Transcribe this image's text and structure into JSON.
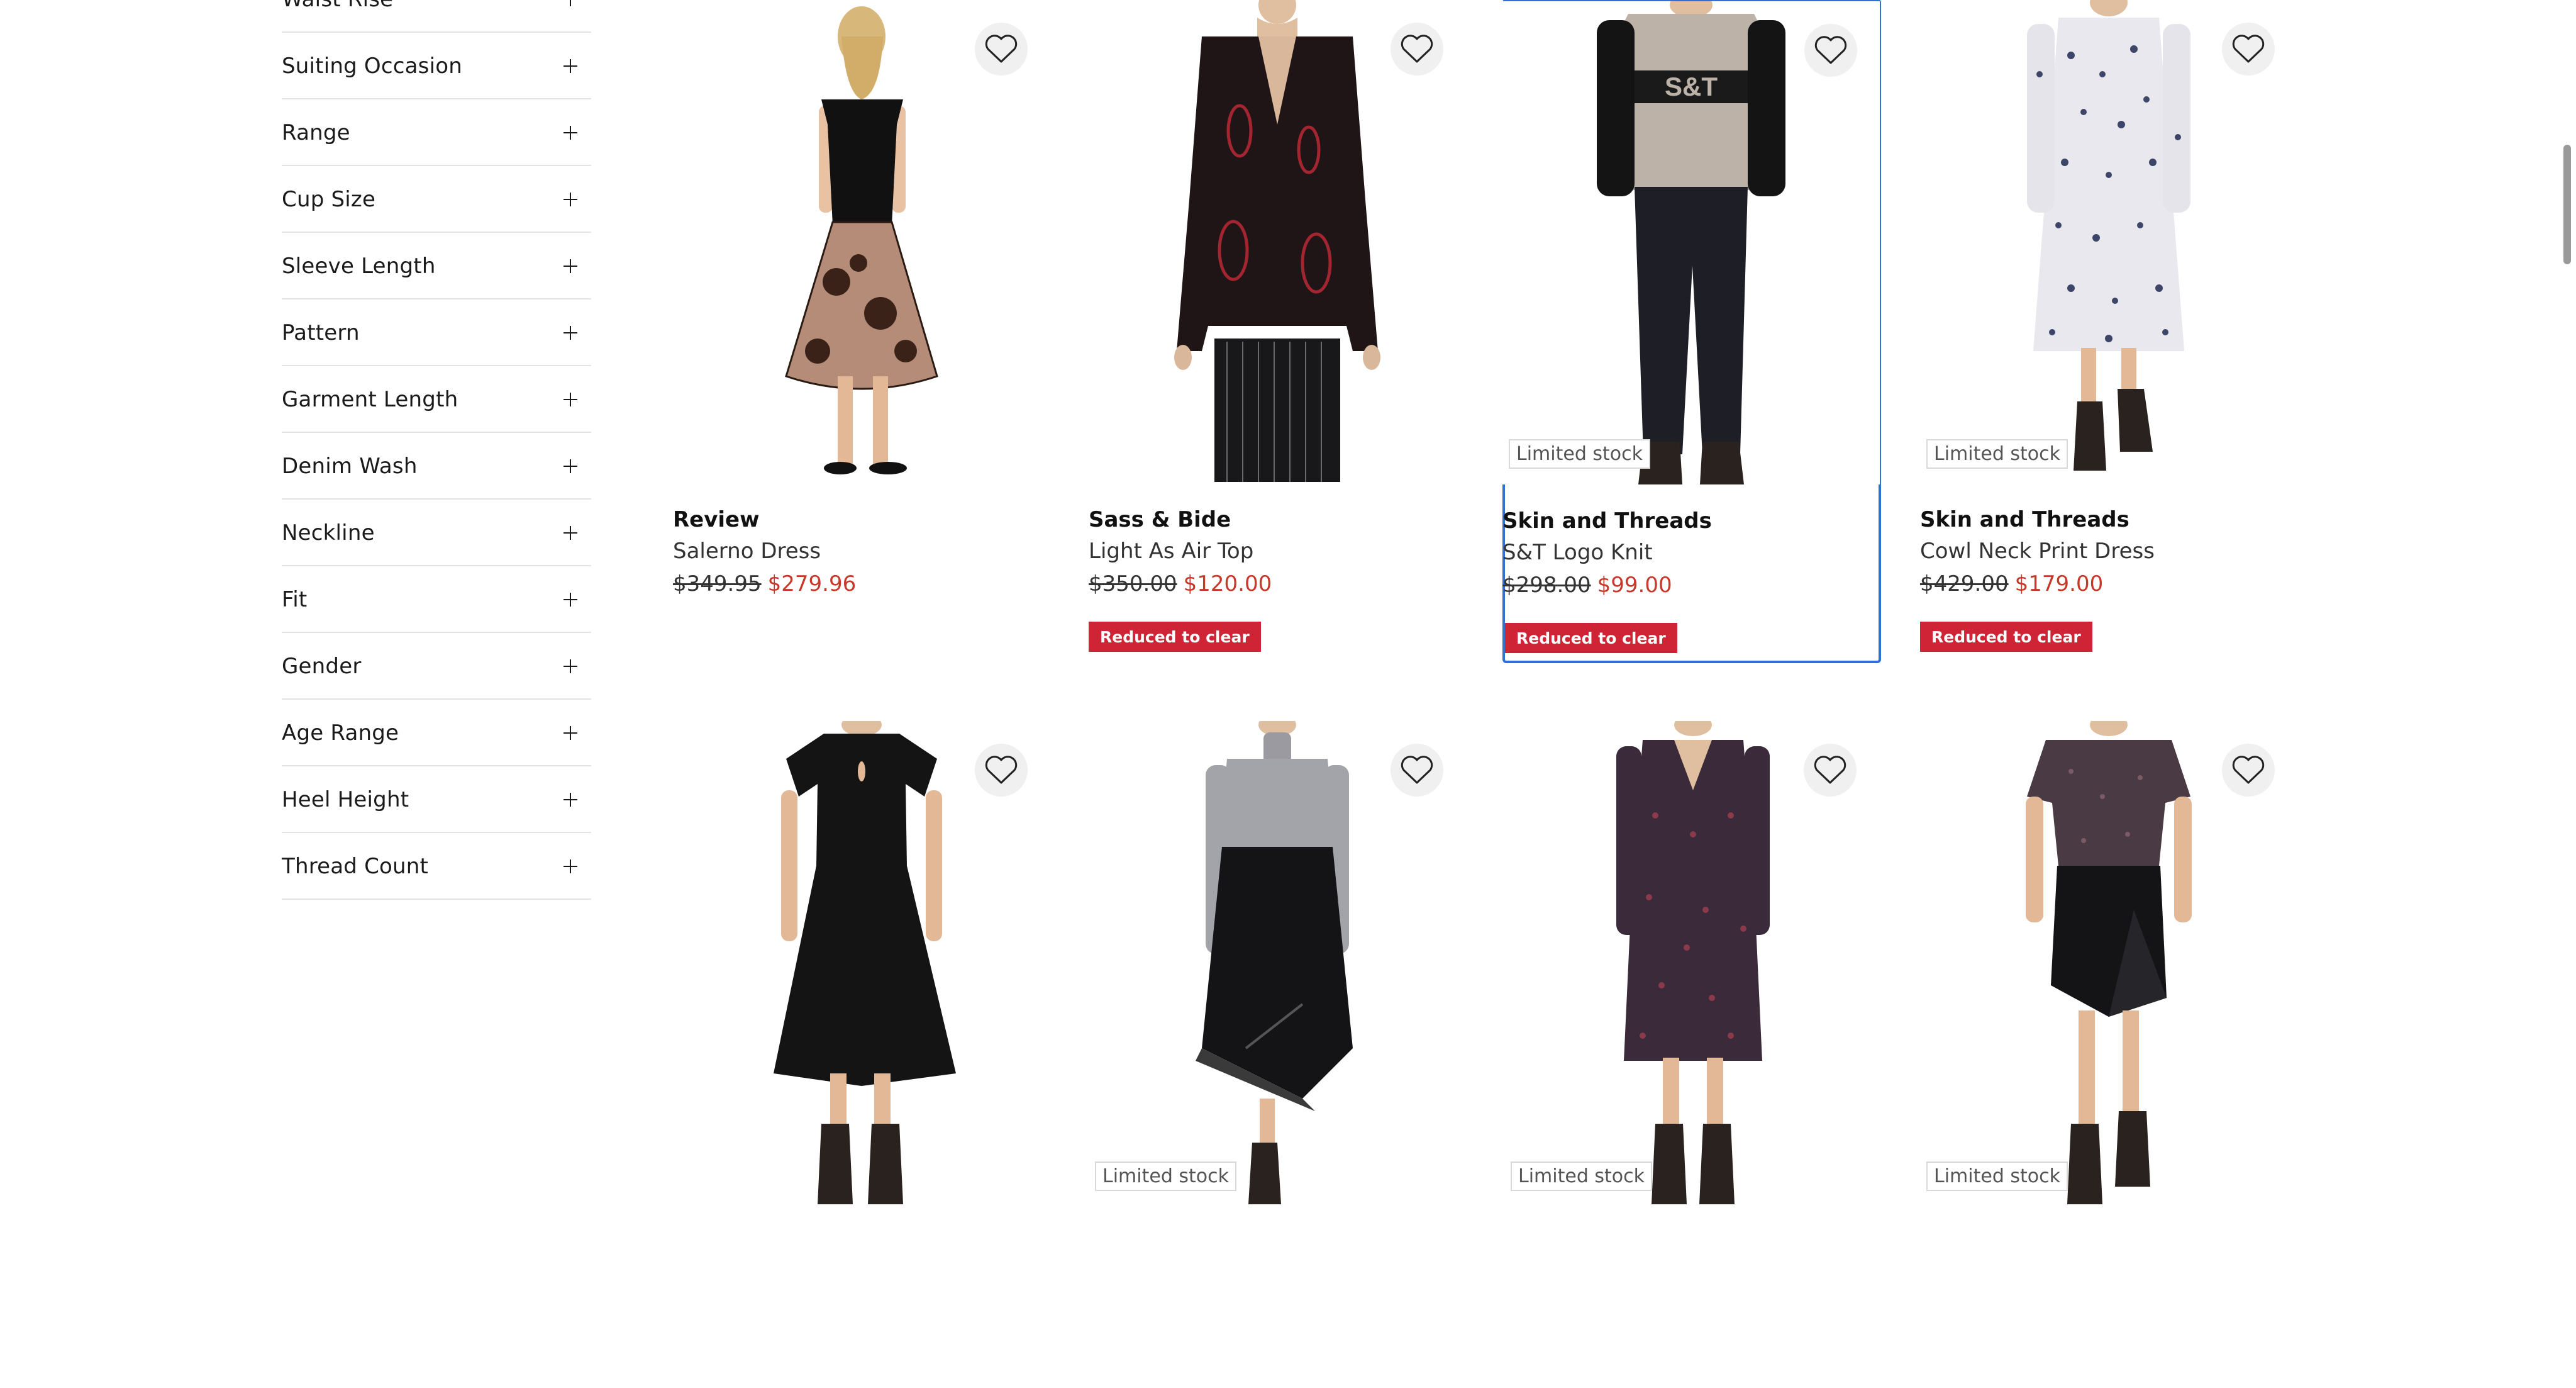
{
  "filters": [
    {
      "label": "Waist Rise"
    },
    {
      "label": "Suiting Occasion"
    },
    {
      "label": "Range"
    },
    {
      "label": "Cup Size"
    },
    {
      "label": "Sleeve Length"
    },
    {
      "label": "Pattern"
    },
    {
      "label": "Garment Length"
    },
    {
      "label": "Denim Wash"
    },
    {
      "label": "Neckline"
    },
    {
      "label": "Fit"
    },
    {
      "label": "Gender"
    },
    {
      "label": "Age Range"
    },
    {
      "label": "Heel Height"
    },
    {
      "label": "Thread Count"
    }
  ],
  "products": [
    {
      "brand": "Review",
      "name": "Salerno Dress",
      "old_price": "$349.95",
      "new_price": "$279.96",
      "badge": "",
      "tag": ""
    },
    {
      "brand": "Sass & Bide",
      "name": "Light As Air Top",
      "old_price": "$350.00",
      "new_price": "$120.00",
      "badge": "",
      "tag": "Reduced to clear"
    },
    {
      "brand": "Skin and Threads",
      "name": "S&T Logo Knit",
      "old_price": "$298.00",
      "new_price": "$99.00",
      "badge": "Limited stock",
      "tag": "Reduced to clear",
      "logo_text": "S&T"
    },
    {
      "brand": "Skin and Threads",
      "name": "Cowl Neck Print Dress",
      "old_price": "$429.00",
      "new_price": "$179.00",
      "badge": "Limited stock",
      "tag": "Reduced to clear"
    },
    {
      "badge": "",
      "tag": ""
    },
    {
      "badge": "Limited stock",
      "tag": ""
    },
    {
      "badge": "Limited stock",
      "tag": ""
    },
    {
      "badge": "Limited stock",
      "tag": ""
    }
  ],
  "colors": {
    "accent": "#2f6fd6",
    "sale_price": "#c6382a",
    "clear_tag": "#cf2435"
  }
}
